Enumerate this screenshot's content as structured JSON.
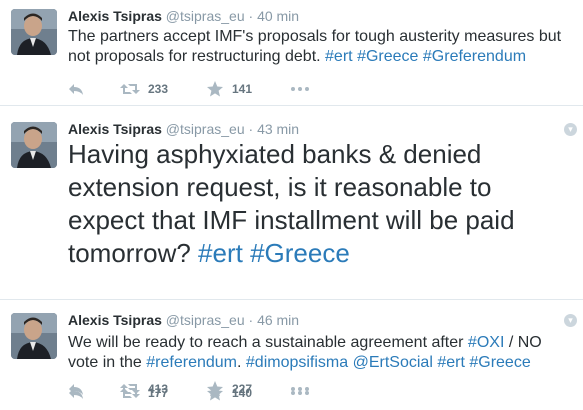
{
  "colors": {
    "link": "#2b7bb9",
    "meta": "#8899a6",
    "text": "#292f33",
    "divider": "#e1e8ed"
  },
  "tweets": [
    {
      "fullname": "Alexis Tsipras",
      "username": "@tsipras_eu",
      "separator": "·",
      "time": "40 min",
      "text_parts": [
        "The partners accept IMF's proposals for tough austerity measures but not proposals for restructuring debt. ",
        "#ert",
        " ",
        "#Greece",
        " ",
        "#Greferendum"
      ],
      "retweets": "233",
      "favorites": "141"
    },
    {
      "fullname": "Alexis Tsipras",
      "username": "@tsipras_eu",
      "separator": "·",
      "time": "43 min",
      "text_parts": [
        "Having asphyxiated banks & denied extension request, is it reasonable to expect that IMF installment will be paid tomorrow? ",
        "#ert",
        " ",
        "#Greece"
      ],
      "retweets": "413",
      "favorites": "227"
    },
    {
      "fullname": "Alexis Tsipras",
      "username": "@tsipras_eu",
      "separator": "·",
      "time": "46 min",
      "text_parts": [
        "We will be ready to reach a sustainable agreement after ",
        "#OXI",
        " / NO vote in the ",
        "#referendum",
        ". ",
        "#dimopsifisma",
        " ",
        "@ErtSocial",
        " ",
        "#ert",
        " ",
        "#Greece"
      ],
      "retweets": "177",
      "favorites": "140"
    }
  ],
  "icons": {
    "reply": "reply-icon",
    "retweet": "retweet-icon",
    "favorite": "star-icon",
    "more": "more-icon",
    "menu": "chevron-down-icon"
  }
}
